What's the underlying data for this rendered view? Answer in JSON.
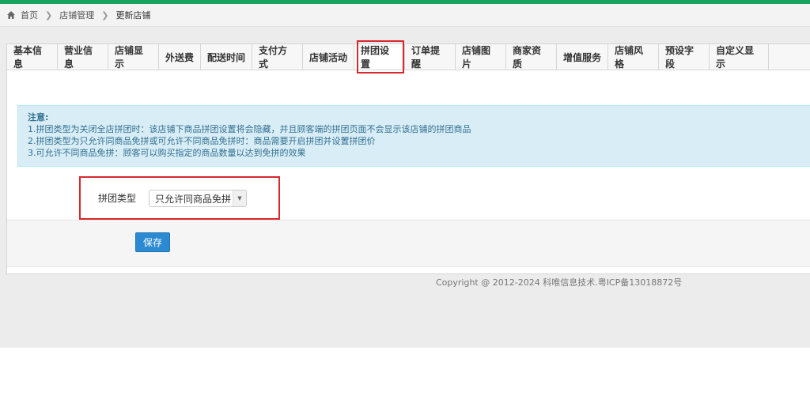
{
  "breadcrumb": {
    "home": "首页",
    "section": "店铺管理",
    "current": "更新店铺"
  },
  "tabs": [
    {
      "label": "基本信息"
    },
    {
      "label": "营业信息"
    },
    {
      "label": "店铺显示"
    },
    {
      "label": "外送费"
    },
    {
      "label": "配送时间"
    },
    {
      "label": "支付方式"
    },
    {
      "label": "店铺活动"
    },
    {
      "label": "拼团设置",
      "active": true
    },
    {
      "label": "订单提醒"
    },
    {
      "label": "店铺图片"
    },
    {
      "label": "商家资质"
    },
    {
      "label": "增值服务"
    },
    {
      "label": "店铺风格"
    },
    {
      "label": "预设字段"
    },
    {
      "label": "自定义显示"
    }
  ],
  "notice": {
    "title": "注意:",
    "line1": "1.拼团类型为关闭全店拼团时：该店铺下商品拼团设置将会隐藏，并且顾客端的拼团页面不会显示该店铺的拼团商品",
    "line2": "2.拼团类型为只允许同商品免拼或可允许不同商品免拼时：商品需要开启拼团并设置拼团价",
    "line3": "3.可允许不同商品免拼：顾客可以购买指定的商品数量以达到免拼的效果"
  },
  "form": {
    "group_type_label": "拼团类型",
    "group_type_value": "只允许同商品免拼",
    "save_label": "保存"
  },
  "footer": {
    "copyright": "Copyright @ 2012-2024 科唯信息技术.粤ICP备13018872号"
  },
  "colors": {
    "accent_green": "#1aa260",
    "highlight_red": "#d9272e",
    "button_blue": "#2b8ad1",
    "notice_bg": "#d9edf7"
  }
}
